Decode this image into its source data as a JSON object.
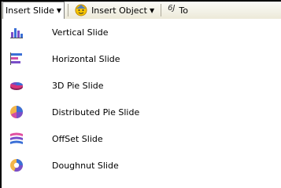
{
  "toolbar": {
    "insert_slide": "Insert Slide",
    "insert_object": "Insert Object",
    "truncated_item": "To",
    "truncated_icon_text": "6J",
    "dropdown_glyph": "▼"
  },
  "menu": {
    "items": [
      {
        "label": "Vertical Slide",
        "icon": "vertical-bar-chart-icon"
      },
      {
        "label": "Horizontal Slide",
        "icon": "horizontal-bar-chart-icon"
      },
      {
        "label": "3D Pie Slide",
        "icon": "3d-pie-chart-icon"
      },
      {
        "label": "Distributed Pie Slide",
        "icon": "distributed-pie-chart-icon"
      },
      {
        "label": "OffSet Slide",
        "icon": "offset-chart-icon"
      },
      {
        "label": "Doughnut Slide",
        "icon": "doughnut-chart-icon"
      }
    ]
  },
  "colors": {
    "toolbar_gradient_top": "#fbfbf8",
    "toolbar_gradient_bottom": "#ece9d8",
    "menu_background": "#ffffff"
  }
}
